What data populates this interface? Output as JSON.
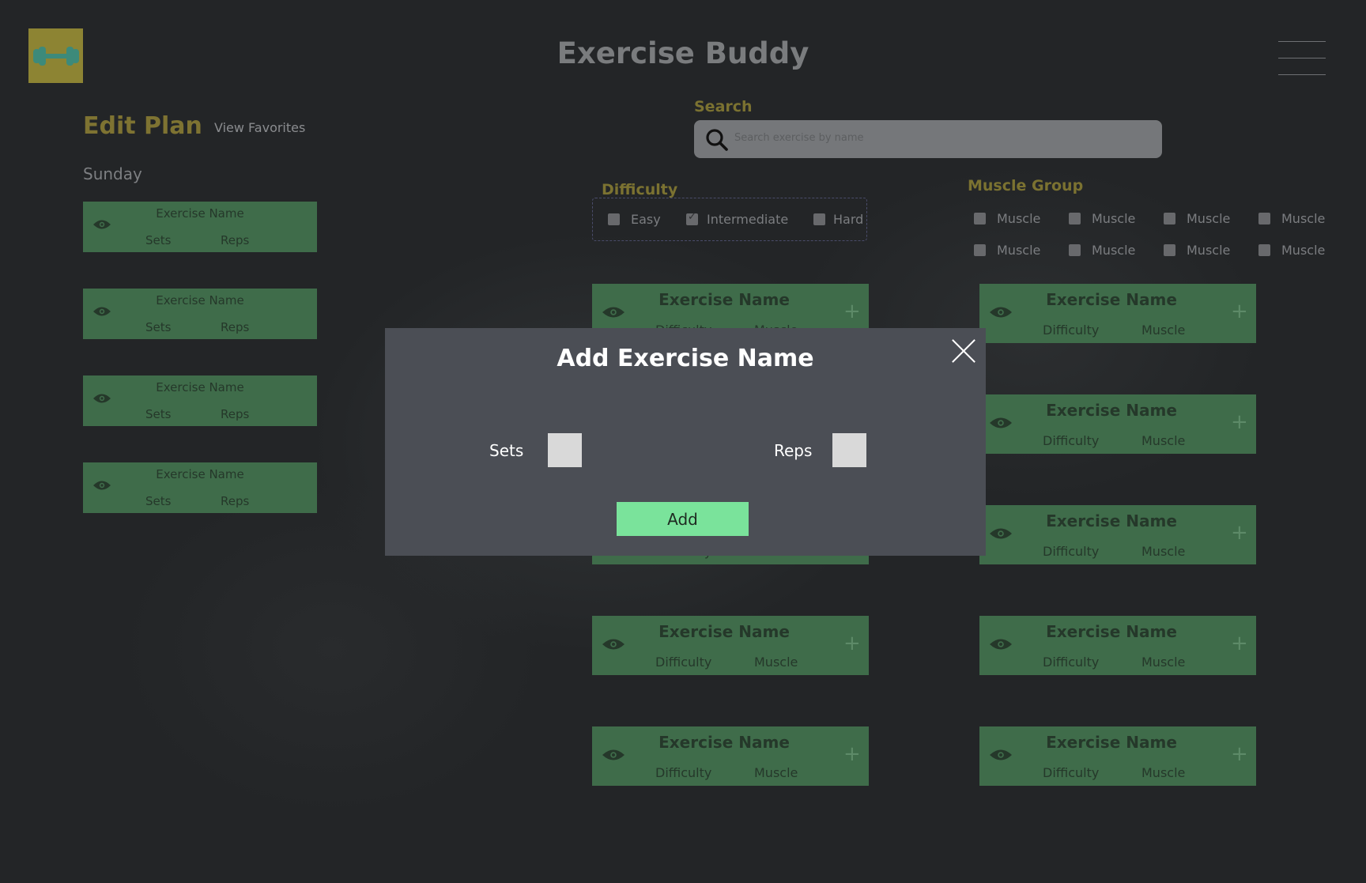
{
  "header": {
    "app_title": "Exercise Buddy",
    "logo_icon": "dumbbell-icon",
    "menu_icon": "hamburger-menu-icon"
  },
  "plan": {
    "title": "Edit Plan",
    "view_favorites": "View Favorites",
    "day": "Sunday",
    "items": [
      {
        "name": "Exercise Name",
        "sets": "Sets",
        "reps": "Reps"
      },
      {
        "name": "Exercise Name",
        "sets": "Sets",
        "reps": "Reps"
      },
      {
        "name": "Exercise Name",
        "sets": "Sets",
        "reps": "Reps"
      },
      {
        "name": "Exercise Name",
        "sets": "Sets",
        "reps": "Reps"
      }
    ]
  },
  "search": {
    "label": "Search",
    "placeholder": "Search exercise by name"
  },
  "difficulty": {
    "label": "Difficulty",
    "options": [
      {
        "label": "Easy",
        "checked": false
      },
      {
        "label": "Intermediate",
        "checked": true
      },
      {
        "label": "Hard",
        "checked": false
      }
    ]
  },
  "muscle_group": {
    "label": "Muscle Group",
    "options": [
      "Muscle",
      "Muscle",
      "Muscle",
      "Muscle",
      "Muscle",
      "Muscle",
      "Muscle",
      "Muscle"
    ]
  },
  "results": {
    "card": {
      "name": "Exercise Name",
      "difficulty": "Difficulty",
      "muscle": "Muscle",
      "add": "+"
    },
    "partial_under_modal": {
      "difficulty": "Difficulty",
      "muscle": "Muscle"
    }
  },
  "modal": {
    "title": "Add Exercise Name",
    "sets_label": "Sets",
    "reps_label": "Reps",
    "add_button": "Add"
  },
  "colors": {
    "background": "#232527",
    "card_green": "#3f6c4a",
    "accent_olive": "#7b7231",
    "modal_bg": "#4b4e55",
    "add_button": "#7ae39b"
  }
}
